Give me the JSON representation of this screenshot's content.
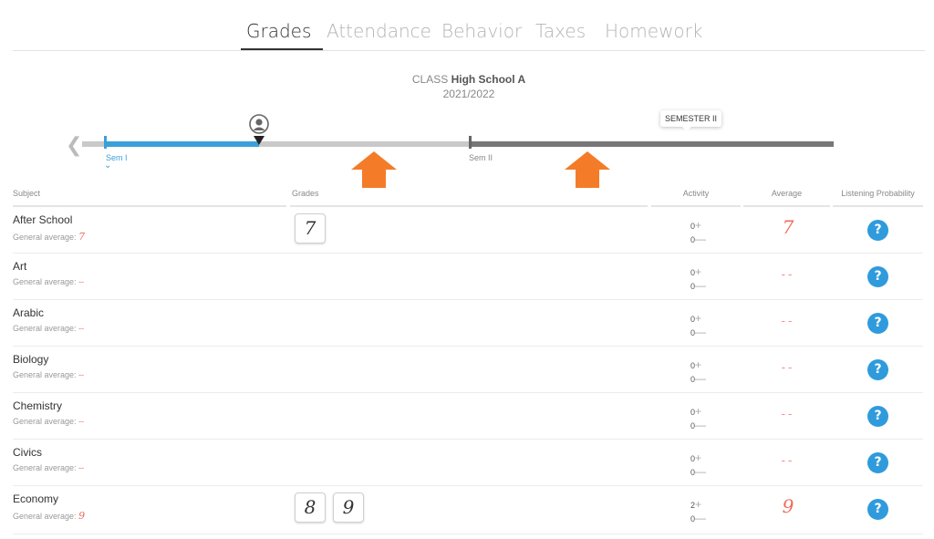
{
  "tabs": [
    {
      "label": "Grades",
      "active": true
    },
    {
      "label": "Attendance",
      "active": false
    },
    {
      "label": "Behavior",
      "active": false
    },
    {
      "label": "Taxes",
      "active": false
    },
    {
      "label": "Homework",
      "active": false
    }
  ],
  "class_info": {
    "prefix": "CLASS",
    "name": "High School A",
    "year": "2021/2022"
  },
  "timeline": {
    "sem1_label": "Sem I",
    "sem2_label": "Sem II",
    "bubble_label": "SEMESTER II",
    "colors": {
      "sem1": "#3aa0da",
      "track": "#c9c9c9",
      "sem2": "#777777",
      "highlight_arrow": "#f47c28"
    }
  },
  "table": {
    "headers": {
      "subject": "Subject",
      "grades": "Grades",
      "activity": "Activity",
      "average": "Average",
      "listening": "Listening Probability"
    },
    "general_average_label": "General average:",
    "rows": [
      {
        "subject": "After School",
        "general_average": "7",
        "grades": [
          "7"
        ],
        "activity_plus": "0",
        "activity_minus": "0",
        "average": "7"
      },
      {
        "subject": "Art",
        "general_average": "--",
        "grades": [],
        "activity_plus": "0",
        "activity_minus": "0",
        "average": "--"
      },
      {
        "subject": "Arabic",
        "general_average": "--",
        "grades": [],
        "activity_plus": "0",
        "activity_minus": "0",
        "average": "--"
      },
      {
        "subject": "Biology",
        "general_average": "--",
        "grades": [],
        "activity_plus": "0",
        "activity_minus": "0",
        "average": "--"
      },
      {
        "subject": "Chemistry",
        "general_average": "--",
        "grades": [],
        "activity_plus": "0",
        "activity_minus": "0",
        "average": "--"
      },
      {
        "subject": "Civics",
        "general_average": "--",
        "grades": [],
        "activity_plus": "0",
        "activity_minus": "0",
        "average": "--"
      },
      {
        "subject": "Economy",
        "general_average": "9",
        "grades": [
          "8",
          "9"
        ],
        "activity_plus": "2",
        "activity_minus": "0",
        "average": "9"
      }
    ],
    "plus_symbol": "+",
    "minus_symbol": "—",
    "help_symbol": "?"
  },
  "icons": {
    "prev": "chevron-left-icon",
    "user_marker": "user-pin-icon",
    "help": "help-circle-icon",
    "arrow": "arrow-up-icon"
  }
}
